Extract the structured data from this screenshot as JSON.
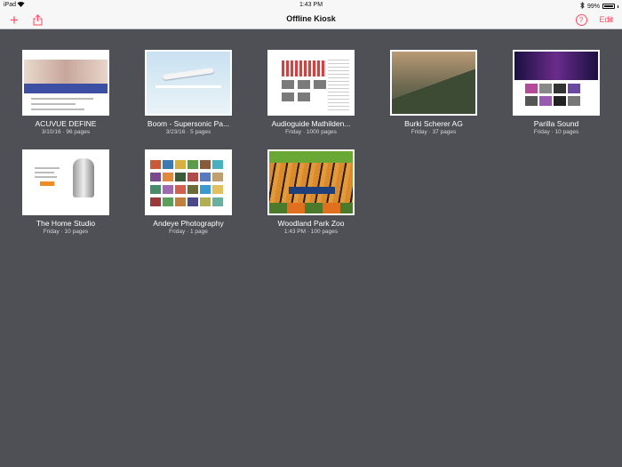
{
  "status_bar": {
    "carrier": "iPad",
    "time": "1:43 PM",
    "battery": "99%"
  },
  "navbar": {
    "title": "Offline Kiosk",
    "edit_label": "Edit",
    "help_label": "?"
  },
  "kiosks": [
    {
      "name": "ACUVUE DEFINE",
      "meta": "3/10/16 · 96 pages"
    },
    {
      "name": "Boom - Supersonic Pa...",
      "meta": "3/23/16 · 5 pages"
    },
    {
      "name": "Audioguide Mathilden...",
      "meta": "Friday · 1000 pages"
    },
    {
      "name": "Burki Scherer AG",
      "meta": "Friday · 37 pages"
    },
    {
      "name": "Parilla Sound",
      "meta": "Friday · 10 pages"
    },
    {
      "name": "The Home Studio",
      "meta": "Friday · 10 pages"
    },
    {
      "name": "Andeye Photography",
      "meta": "Friday · 1 page"
    },
    {
      "name": "Woodland Park Zoo",
      "meta": "1:43 PM · 100 pages"
    }
  ],
  "icons": {
    "add": "plus-icon",
    "share": "share-icon",
    "help": "help-icon",
    "wifi": "wifi-icon",
    "bluetooth": "bluetooth-icon",
    "battery": "battery-icon"
  },
  "colors": {
    "accent": "#ff4b62",
    "background": "#4f5055",
    "bar": "#f7f7f7"
  }
}
